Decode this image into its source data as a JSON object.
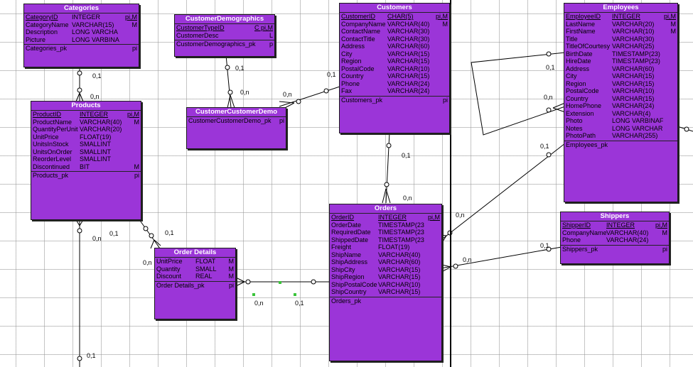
{
  "diagram": {
    "entities": {
      "categories": {
        "title": "Categories",
        "rows": [
          {
            "name": "CategoryID",
            "type": "INTEGER",
            "flag": "pi,M"
          },
          {
            "name": "CategoryName",
            "type": "VARCHAR(15)",
            "flag": "M"
          },
          {
            "name": "Description",
            "type": "LONG VARCHA",
            "flag": ""
          },
          {
            "name": "Picture",
            "type": "LONG VARBINA",
            "flag": ""
          }
        ],
        "pk": "Categories_pk",
        "pk_flag": "pi"
      },
      "customer_demographics": {
        "title": "CustomerDemographics",
        "rows": [
          {
            "name": "CustomerTypeID",
            "type": "",
            "flag": "C  pi,M"
          },
          {
            "name": "CustomerDesc",
            "type": "",
            "flag": "L"
          }
        ],
        "pk": "CustomerDemographics_pk",
        "pk_flag": "p"
      },
      "customers": {
        "title": "Customers",
        "rows": [
          {
            "name": "CustomerID",
            "type": "CHAR(5)",
            "flag": "pi,M"
          },
          {
            "name": "CompanyName",
            "type": "VARCHAR(40)",
            "flag": "M"
          },
          {
            "name": "ContactName",
            "type": "VARCHAR(30)",
            "flag": ""
          },
          {
            "name": "ContactTitle",
            "type": "VARCHAR(30)",
            "flag": ""
          },
          {
            "name": "Address",
            "type": "VARCHAR(60)",
            "flag": ""
          },
          {
            "name": "City",
            "type": "VARCHAR(15)",
            "flag": ""
          },
          {
            "name": "Region",
            "type": "VARCHAR(15)",
            "flag": ""
          },
          {
            "name": "PostalCode",
            "type": "VARCHAR(10)",
            "flag": ""
          },
          {
            "name": "Country",
            "type": "VARCHAR(15)",
            "flag": ""
          },
          {
            "name": "Phone",
            "type": "VARCHAR(24)",
            "flag": ""
          },
          {
            "name": "Fax",
            "type": "VARCHAR(24)",
            "flag": ""
          }
        ],
        "pk": "Customers_pk",
        "pk_flag": "pi"
      },
      "employees": {
        "title": "Employees",
        "rows": [
          {
            "name": "EmployeeID",
            "type": "INTEGER",
            "flag": "pi,M"
          },
          {
            "name": "LastName",
            "type": "VARCHAR(20)",
            "flag": "M"
          },
          {
            "name": "FirstName",
            "type": "VARCHAR(10)",
            "flag": "M"
          },
          {
            "name": "Title",
            "type": "VARCHAR(30)",
            "flag": ""
          },
          {
            "name": "TitleOfCourtesy",
            "type": "VARCHAR(25)",
            "flag": ""
          },
          {
            "name": "BirthDate",
            "type": "TIMESTAMP(23)",
            "flag": ""
          },
          {
            "name": "HireDate",
            "type": "TIMESTAMP(23)",
            "flag": ""
          },
          {
            "name": "Address",
            "type": "VARCHAR(60)",
            "flag": ""
          },
          {
            "name": "City",
            "type": "VARCHAR(15)",
            "flag": ""
          },
          {
            "name": "Region",
            "type": "VARCHAR(15)",
            "flag": ""
          },
          {
            "name": "PostalCode",
            "type": "VARCHAR(10)",
            "flag": ""
          },
          {
            "name": "Country",
            "type": "VARCHAR(15)",
            "flag": ""
          },
          {
            "name": "HomePhone",
            "type": "VARCHAR(24)",
            "flag": ""
          },
          {
            "name": "Extension",
            "type": "VARCHAR(4)",
            "flag": ""
          },
          {
            "name": "Photo",
            "type": "LONG VARBINAF",
            "flag": ""
          },
          {
            "name": "Notes",
            "type": "LONG VARCHAR",
            "flag": ""
          },
          {
            "name": "PhotoPath",
            "type": "VARCHAR(255)",
            "flag": ""
          }
        ],
        "pk": "Employees_pk",
        "pk_flag": ""
      },
      "products": {
        "title": "Products",
        "rows": [
          {
            "name": "ProductID",
            "type": "INTEGER",
            "flag": "pi,M"
          },
          {
            "name": "ProductName",
            "type": "VARCHAR(40)",
            "flag": "M"
          },
          {
            "name": "QuantityPerUnit",
            "type": "VARCHAR(20)",
            "flag": ""
          },
          {
            "name": "UnitPrice",
            "type": "FLOAT(19)",
            "flag": ""
          },
          {
            "name": "UnitsInStock",
            "type": "SMALLINT",
            "flag": ""
          },
          {
            "name": "UnitsOnOrder",
            "type": "SMALLINT",
            "flag": ""
          },
          {
            "name": "ReorderLevel",
            "type": "SMALLINT",
            "flag": ""
          },
          {
            "name": "Discontinued",
            "type": "BIT",
            "flag": "M"
          }
        ],
        "pk": "Products_pk",
        "pk_flag": "pi"
      },
      "customer_customer_demo": {
        "title": "CustomerCustomerDemo",
        "rows": [],
        "pk": "CustomerCustomerDemo_pk",
        "pk_flag": "pi"
      },
      "orders": {
        "title": "Orders",
        "rows": [
          {
            "name": "OrderID",
            "type": "INTEGER",
            "flag": "pi,M"
          },
          {
            "name": "OrderDate",
            "type": "TIMESTAMP(23",
            "flag": ""
          },
          {
            "name": "RequiredDate",
            "type": "TIMESTAMP(23",
            "flag": ""
          },
          {
            "name": "ShippedDate",
            "type": "TIMESTAMP(23",
            "flag": ""
          },
          {
            "name": "Freight",
            "type": "FLOAT(19)",
            "flag": ""
          },
          {
            "name": "ShipName",
            "type": "VARCHAR(40)",
            "flag": ""
          },
          {
            "name": "ShipAddress",
            "type": "VARCHAR(60)",
            "flag": ""
          },
          {
            "name": "ShipCity",
            "type": "VARCHAR(15)",
            "flag": ""
          },
          {
            "name": "ShipRegion",
            "type": "VARCHAR(15)",
            "flag": ""
          },
          {
            "name": "ShipPostalCode",
            "type": "VARCHAR(10)",
            "flag": ""
          },
          {
            "name": "ShipCountry",
            "type": "VARCHAR(15)",
            "flag": ""
          }
        ],
        "pk": "Orders_pk",
        "pk_flag": ""
      },
      "order_details": {
        "title": "Order Details",
        "rows": [
          {
            "name": "UnitPrice",
            "type": "FLOAT",
            "flag": "M"
          },
          {
            "name": "Quantity",
            "type": "SMALL",
            "flag": "M"
          },
          {
            "name": "Discount",
            "type": "REAL",
            "flag": "M"
          }
        ],
        "pk": "Order Details_pk",
        "pk_flag": "pi"
      },
      "shippers": {
        "title": "Shippers",
        "rows": [
          {
            "name": "ShipperID",
            "type": "INTEGER",
            "flag": "pi,M"
          },
          {
            "name": "CompanyName",
            "type": "VARCHAR(40)",
            "flag": "M"
          },
          {
            "name": "Phone",
            "type": "VARCHAR(24)",
            "flag": ""
          }
        ],
        "pk": "Shippers_pk",
        "pk_flag": "pi"
      }
    },
    "cardinalities": {
      "c01": "0,1",
      "c02": "0,n",
      "c03": "0,1",
      "c04": "0,n",
      "c05": "0,n",
      "c06": "0,1",
      "c07": "0,1",
      "c08": "0,n",
      "c09": "0,1",
      "c10": "0,n",
      "c11": "0,1",
      "c12": "0,n",
      "c13": "0,1",
      "c14": "0,n",
      "c15": "0,n",
      "c16": "0,1",
      "c17": "0,n",
      "c18": "0,1",
      "c19": "0,n",
      "c20": "0,1",
      "c21": "0,n",
      "c22": "0,1"
    },
    "colors": {
      "entity_fill": "#9b35d8",
      "grid": "#969696",
      "line": "#000000"
    }
  }
}
